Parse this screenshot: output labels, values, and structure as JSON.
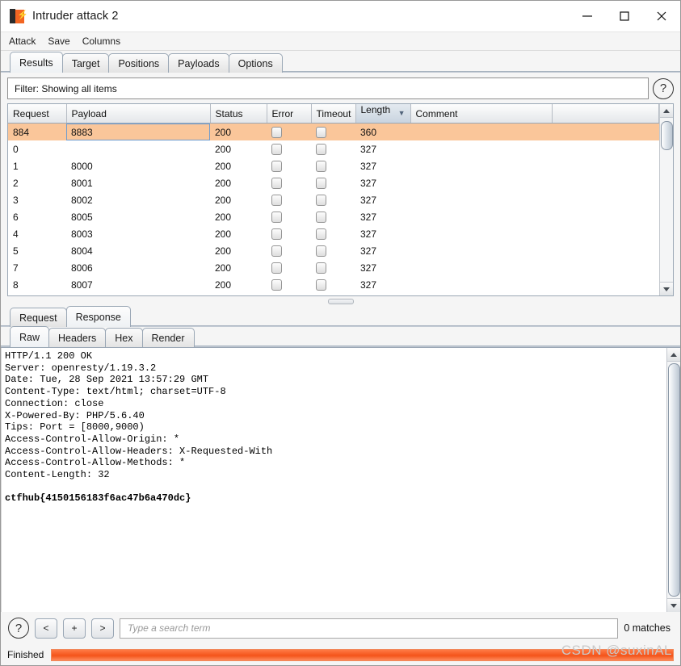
{
  "window": {
    "title": "Intruder attack 2",
    "icon": "burp-suite-icon",
    "bolt": "⚡",
    "controls": {
      "minimize": "minimize-icon",
      "maximize": "maximize-icon",
      "close": "close-icon"
    }
  },
  "menubar": {
    "items": [
      "Attack",
      "Save",
      "Columns"
    ]
  },
  "main_tabs": {
    "items": [
      "Results",
      "Target",
      "Positions",
      "Payloads",
      "Options"
    ],
    "active": "Results"
  },
  "filter": {
    "label": "Filter: Showing all items",
    "help_icon": "question-mark-icon"
  },
  "results_table": {
    "columns": [
      "Request",
      "Payload",
      "Status",
      "Error",
      "Timeout",
      "Length",
      "Comment"
    ],
    "sorted_column": "Length",
    "sort_direction": "▼",
    "rows": [
      {
        "request": "884",
        "payload": "8883",
        "status": "200",
        "error": false,
        "timeout": false,
        "length": "360",
        "comment": "",
        "selected": true
      },
      {
        "request": "0",
        "payload": "",
        "status": "200",
        "error": false,
        "timeout": false,
        "length": "327",
        "comment": "",
        "selected": false
      },
      {
        "request": "1",
        "payload": "8000",
        "status": "200",
        "error": false,
        "timeout": false,
        "length": "327",
        "comment": "",
        "selected": false
      },
      {
        "request": "2",
        "payload": "8001",
        "status": "200",
        "error": false,
        "timeout": false,
        "length": "327",
        "comment": "",
        "selected": false
      },
      {
        "request": "3",
        "payload": "8002",
        "status": "200",
        "error": false,
        "timeout": false,
        "length": "327",
        "comment": "",
        "selected": false
      },
      {
        "request": "6",
        "payload": "8005",
        "status": "200",
        "error": false,
        "timeout": false,
        "length": "327",
        "comment": "",
        "selected": false
      },
      {
        "request": "4",
        "payload": "8003",
        "status": "200",
        "error": false,
        "timeout": false,
        "length": "327",
        "comment": "",
        "selected": false
      },
      {
        "request": "5",
        "payload": "8004",
        "status": "200",
        "error": false,
        "timeout": false,
        "length": "327",
        "comment": "",
        "selected": false
      },
      {
        "request": "7",
        "payload": "8006",
        "status": "200",
        "error": false,
        "timeout": false,
        "length": "327",
        "comment": "",
        "selected": false
      },
      {
        "request": "8",
        "payload": "8007",
        "status": "200",
        "error": false,
        "timeout": false,
        "length": "327",
        "comment": "",
        "selected": false
      }
    ]
  },
  "message_tabs": {
    "items": [
      "Request",
      "Response"
    ],
    "active": "Response"
  },
  "view_tabs": {
    "items": [
      "Raw",
      "Headers",
      "Hex",
      "Render"
    ],
    "active": "Raw"
  },
  "response": {
    "headers": "HTTP/1.1 200 OK\nServer: openresty/1.19.3.2\nDate: Tue, 28 Sep 2021 13:57:29 GMT\nContent-Type: text/html; charset=UTF-8\nConnection: close\nX-Powered-By: PHP/5.6.40\nTips: Port = [8000,9000)\nAccess-Control-Allow-Origin: *\nAccess-Control-Allow-Headers: X-Requested-With\nAccess-Control-Allow-Methods: *\nContent-Length: 32\n",
    "body": "ctfhub{4150156183f6ac47b6a470dc}"
  },
  "search": {
    "help_icon": "question-mark-icon",
    "prev_label": "<",
    "add_label": "+",
    "next_label": ">",
    "placeholder": "Type a search term",
    "value": "",
    "matches": "0 matches"
  },
  "status": {
    "text": "Finished",
    "progress_percent": 100,
    "watermark": "CSDN @suxinAL"
  },
  "colors": {
    "selected_row": "#fac69a",
    "progress": "#f4541a",
    "accent": "#f26522",
    "tab_border": "#9aa7b5"
  }
}
